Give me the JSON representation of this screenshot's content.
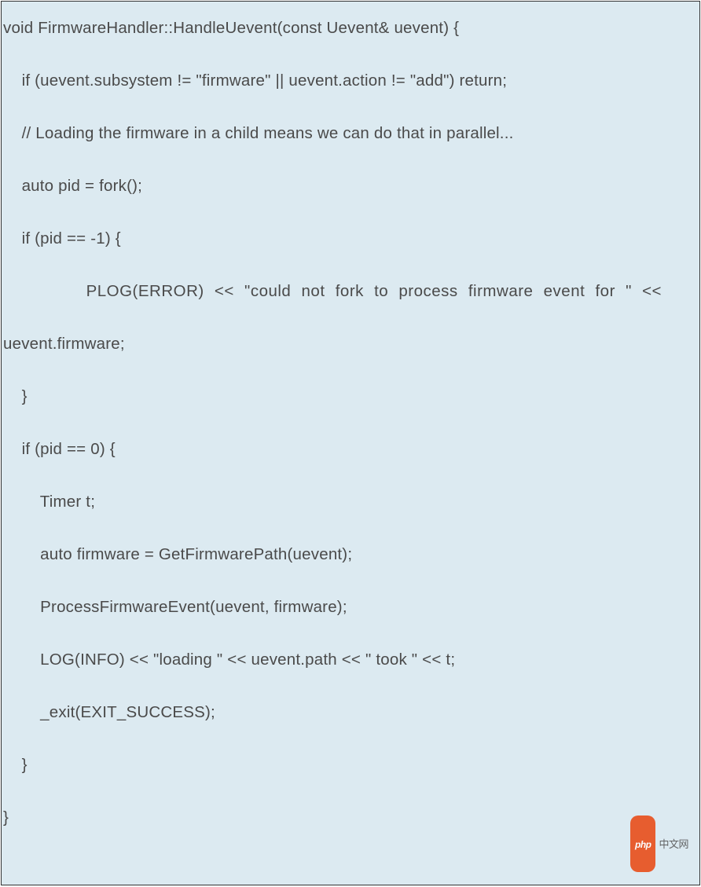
{
  "code": {
    "lines": [
      "void FirmwareHandler::HandleUevent(const Uevent& uevent) {",
      "    if (uevent.subsystem != \"firmware\" || uevent.action != \"add\") return;",
      "",
      "    // Loading the firmware in a child means we can do that in parallel...",
      "    auto pid = fork();",
      "    if (pid == -1) {",
      "        PLOG(ERROR) << \"could not fork to process firmware event for \" <<",
      "uevent.firmware;",
      "    }",
      "    if (pid == 0) {",
      "        Timer t;",
      "        auto firmware = GetFirmwarePath(uevent);",
      "        ProcessFirmwareEvent(uevent, firmware);",
      "        LOG(INFO) << \"loading \" << uevent.path << \" took \" << t;",
      "        _exit(EXIT_SUCCESS);",
      "    }",
      "}"
    ]
  },
  "watermark": {
    "pill": "php",
    "text": "中文网"
  },
  "colors": {
    "bg": "#DCEAF1",
    "text": "#4A4A4A",
    "border": "#333333",
    "wm_pill": "#E94E1B"
  }
}
